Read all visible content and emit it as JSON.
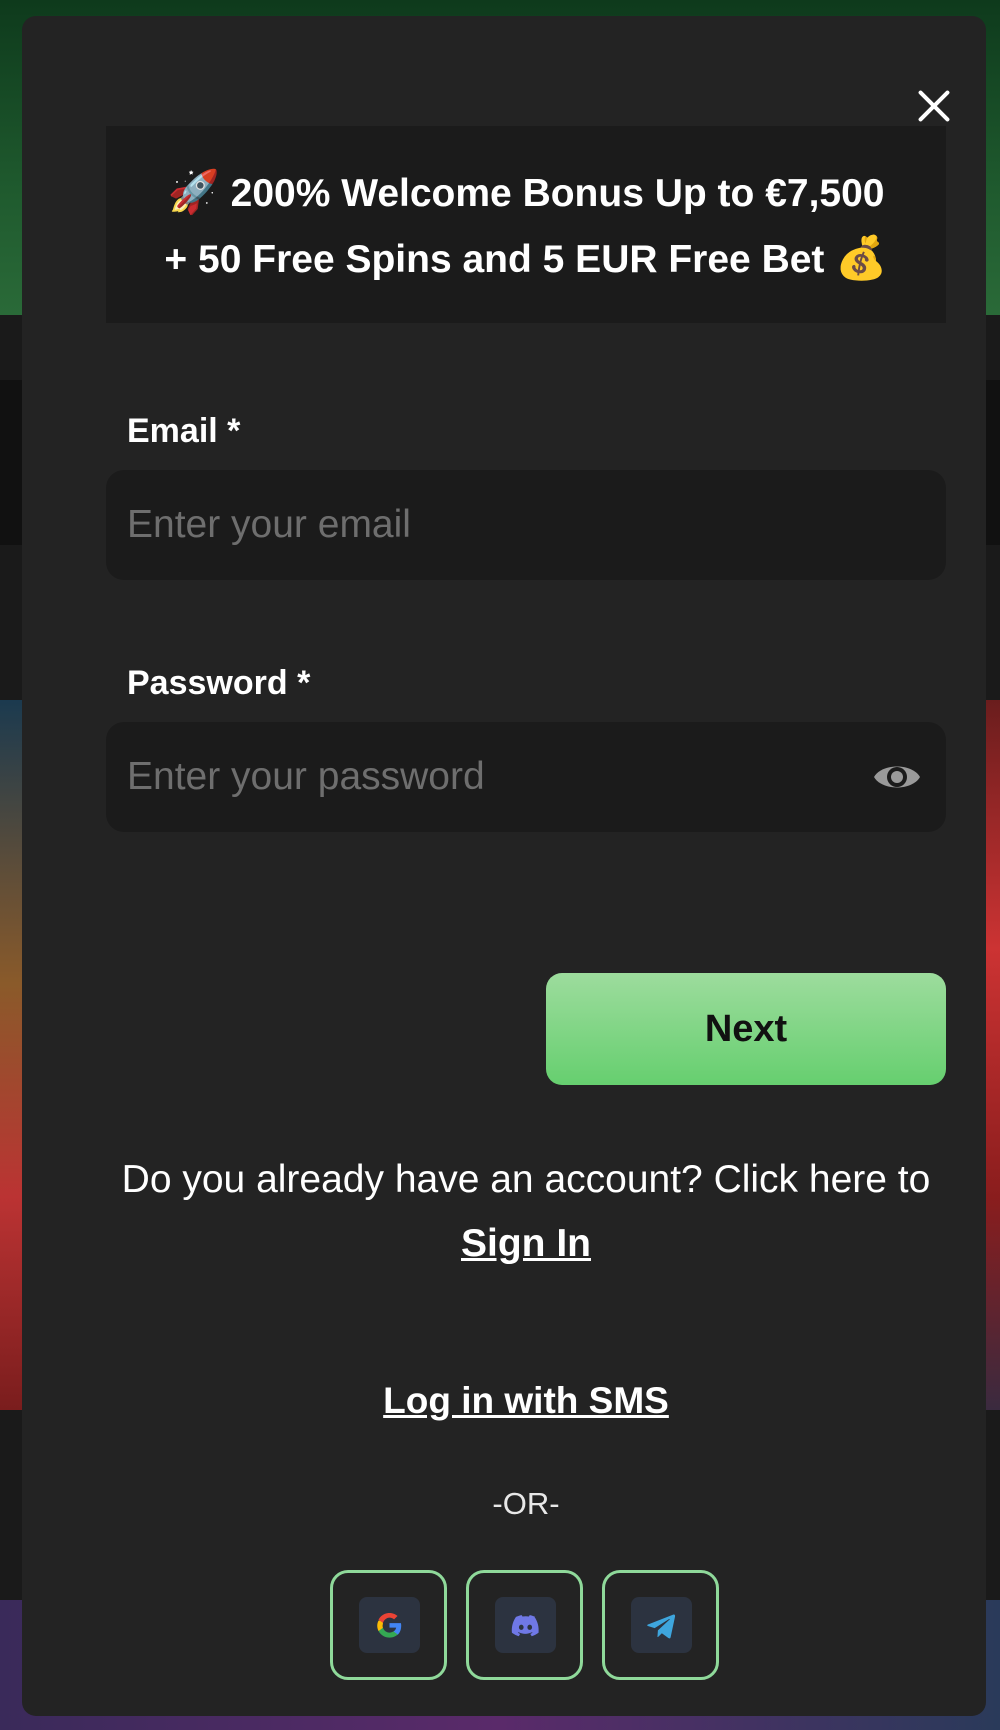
{
  "banner": {
    "rocket_emoji": "🚀",
    "line1": "200% Welcome Bonus Up to €7,500",
    "line2": "+ 50 Free Spins and 5 EUR Free Bet",
    "money_emoji": "💰"
  },
  "form": {
    "email_label": "Email *",
    "email_placeholder": "Enter your email",
    "password_label": "Password *",
    "password_placeholder": "Enter your password",
    "next_label": "Next"
  },
  "account": {
    "prompt": "Do you already have an account? Click here to ",
    "signin_label": "Sign In"
  },
  "sms_label": "Log in with SMS",
  "or_label": "-OR-",
  "social": [
    {
      "name": "google",
      "icon": "google-icon"
    },
    {
      "name": "discord",
      "icon": "discord-icon"
    },
    {
      "name": "telegram",
      "icon": "telegram-icon"
    }
  ],
  "colors": {
    "modal_bg": "#232323",
    "field_bg": "#1b1b1b",
    "accent_green": "#7bd683",
    "social_border": "#8fd99a"
  }
}
